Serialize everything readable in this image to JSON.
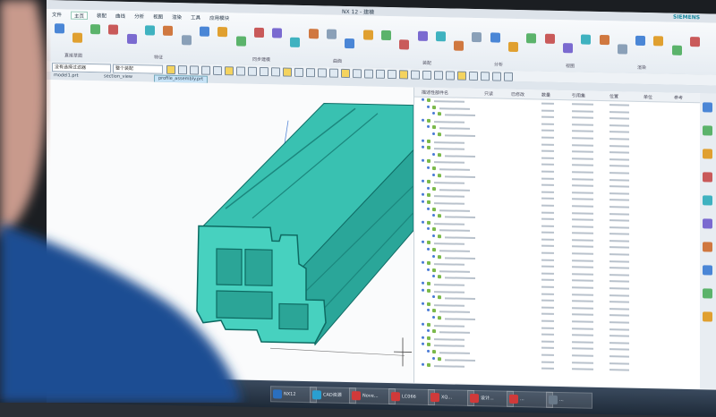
{
  "app": {
    "window_title": "NX 12 - 建模",
    "brand": "SIEMENS"
  },
  "ribbon": {
    "tabs": [
      "文件",
      "主页",
      "装配",
      "曲线",
      "分析",
      "视图",
      "渲染",
      "工具",
      "应用模块"
    ],
    "active_tab": "主页",
    "groups": [
      "直接草图",
      "特征",
      "同步建模",
      "曲面",
      "装配",
      "分析",
      "视图",
      "渲染"
    ]
  },
  "toolbar": {
    "filter_value": "没有选择过滤器",
    "scope_value": "整个装配"
  },
  "view_tabs": [
    "model1.prt",
    "section_view",
    "profile_assembly.prt"
  ],
  "navigator": {
    "columns": [
      "描述性部件名",
      "只读",
      "已修改",
      "数量",
      "引用集",
      "位置",
      "单位",
      "参考"
    ],
    "rows": 40
  },
  "taskbar": {
    "items": [
      "NX12",
      "CAD资源",
      "Nove...",
      "LC066",
      "XQ...",
      "设计...",
      "...",
      "..."
    ]
  },
  "colors": {
    "part_teal": "#2fb3a5",
    "part_teal_dark": "#1d8a82",
    "ribbon_bg": "#eef2f6",
    "navigator_bg": "#ffffff"
  }
}
